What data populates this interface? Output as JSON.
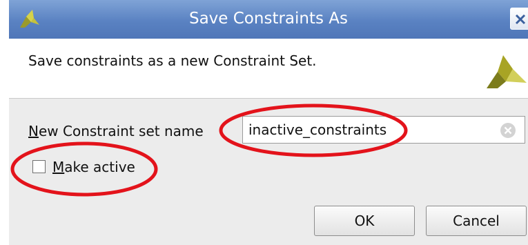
{
  "window": {
    "title": "Save Constraints As",
    "app_icon": "xilinx-logo-icon",
    "close_icon": "close-icon"
  },
  "header": {
    "description": "Save constraints as a new Constraint Set.",
    "logo_icon": "xilinx-logo-icon"
  },
  "form": {
    "name_label": "New Constraint set name",
    "name_mnemonic": "N",
    "name_label_rest": "ew Constraint set name",
    "name_value": "inactive_constraints",
    "clear_icon": "clear-icon",
    "make_active_mnemonic": "M",
    "make_active_rest": "ake active",
    "make_active_checked": false
  },
  "buttons": {
    "ok": "OK",
    "cancel": "Cancel"
  },
  "annotations": {
    "highlight_color": "#e3131b"
  }
}
